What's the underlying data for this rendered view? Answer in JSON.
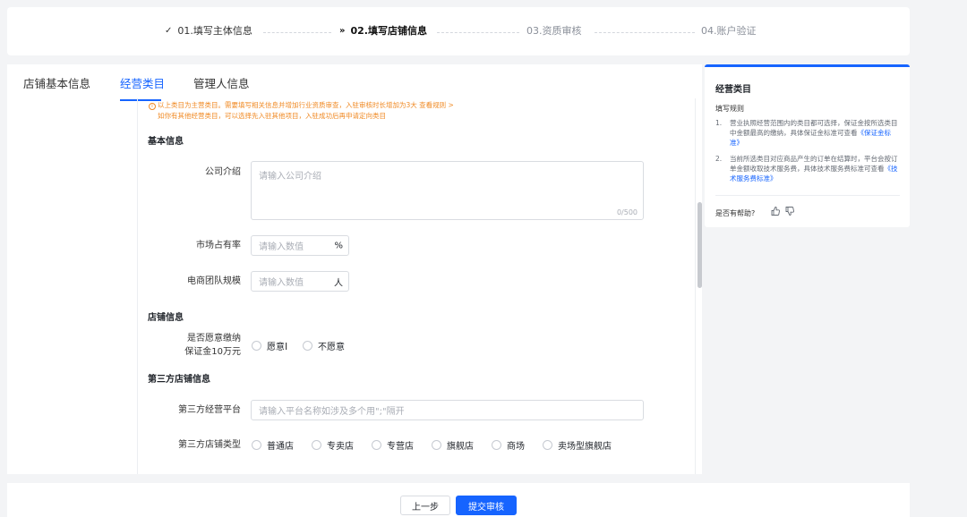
{
  "steps": [
    {
      "mark": "✓",
      "label": "01.填写主体信息",
      "state": "done"
    },
    {
      "mark": "»",
      "label": "02.填写店铺信息",
      "state": "active"
    },
    {
      "mark": "",
      "label": "03.资质审核",
      "state": "todo"
    },
    {
      "mark": "",
      "label": "04.账户验证",
      "state": "todo"
    }
  ],
  "tabs": [
    {
      "label": "店铺基本信息"
    },
    {
      "label": "经营类目"
    },
    {
      "label": "管理人信息"
    }
  ],
  "notice": {
    "line1": "以上类目为主营类目。需要填写相关信息并增加行业资质审查，入驻审核时长增加为3大  查看规则 >",
    "line2": "如你有其他经营类目，可以选择先入驻其他项目，入驻成功后再申请定向类目"
  },
  "form": {
    "basic_title": "基本信息",
    "company_intro": {
      "label": "公司介绍",
      "placeholder": "请输入公司介绍",
      "counter": "0/500"
    },
    "market_share": {
      "label": "市场占有率",
      "placeholder": "请输入数值",
      "suffix": "%"
    },
    "team_size": {
      "label": "电商团队规模",
      "placeholder": "请输入数值",
      "suffix": "人"
    },
    "shop_title": "店铺信息",
    "deposit": {
      "label_line1": "是否愿意缴纳",
      "label_line2": "保证金10万元",
      "options": [
        "愿意",
        "不愿意"
      ]
    },
    "third_title": "第三方店铺信息",
    "third_platform": {
      "label": "第三方经营平台",
      "placeholder": "请输入平台名称如涉及多个用\";\"隔开"
    },
    "third_type": {
      "label": "第三方店铺类型",
      "options": [
        "普通店",
        "专卖店",
        "专营店",
        "旗舰店",
        "商场",
        "卖场型旗舰店"
      ]
    }
  },
  "side": {
    "title": "经营类目",
    "rule_title": "填写规则",
    "items": [
      {
        "num": "1.",
        "text": "营业执照经营范围内的类目都可选择，保证金按所选类目中金额最高的缴纳，具体保证金标准可查看",
        "link": "《保证金标准》"
      },
      {
        "num": "2.",
        "text": "当前所选类目对应商品产生的订单在结算时，平台会按订单金额收取技术服务费，具体技术服务费标准可查看",
        "link": "《技术服务费标准》"
      }
    ],
    "helpful": "是否有帮助?"
  },
  "footer": {
    "prev": "上一步",
    "submit": "提交审核"
  },
  "colors": {
    "accent": "#1664ff",
    "warning": "#f08a24"
  }
}
